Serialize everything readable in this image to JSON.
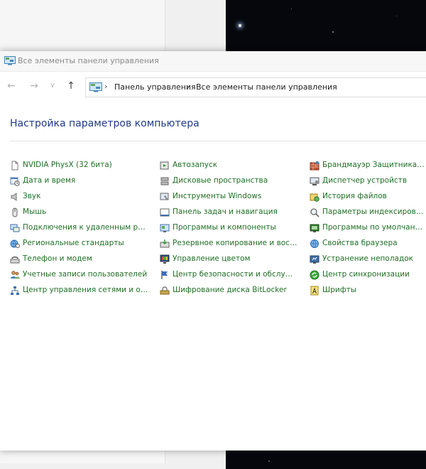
{
  "window": {
    "title": "Все элементы панели управления"
  },
  "navigation": {
    "back_glyph": "←",
    "forward_glyph": "→",
    "recent_glyph": "∨",
    "up_glyph": "↑",
    "separator": "›",
    "breadcrumbs": [
      "Панель управления",
      "Все элементы панели управления"
    ]
  },
  "main": {
    "heading": "Настройка параметров компьютера",
    "columns": [
      [
        {
          "label": "NVIDIA PhysX (32 бита)",
          "icon": "document-icon"
        },
        {
          "label": "Дата и время",
          "icon": "calendar-clock-icon"
        },
        {
          "label": "Звук",
          "icon": "speaker-icon"
        },
        {
          "label": "Мышь",
          "icon": "mouse-icon"
        },
        {
          "label": "Подключения к удаленным рабоч...",
          "icon": "remote-desktop-icon"
        },
        {
          "label": "Региональные стандарты",
          "icon": "globe-clock-icon"
        },
        {
          "label": "Телефон и модем",
          "icon": "phone-modem-icon"
        },
        {
          "label": "Учетные записи пользователей",
          "icon": "users-icon"
        },
        {
          "label": "Центр управления сетями и общи...",
          "icon": "network-icon"
        }
      ],
      [
        {
          "label": "Автозапуск",
          "icon": "autoplay-icon"
        },
        {
          "label": "Дисковые пространства",
          "icon": "storage-spaces-icon"
        },
        {
          "label": "Инструменты Windows",
          "icon": "windows-tools-icon"
        },
        {
          "label": "Панель задач и навигация",
          "icon": "taskbar-icon"
        },
        {
          "label": "Программы и компоненты",
          "icon": "programs-icon"
        },
        {
          "label": "Резервное копирование и восстан...",
          "icon": "backup-icon"
        },
        {
          "label": "Управление цветом",
          "icon": "color-monitor-icon"
        },
        {
          "label": "Центр безопасности и обслуживан...",
          "icon": "flag-icon"
        },
        {
          "label": "Шифрование диска BitLocker",
          "icon": "bitlocker-icon"
        }
      ],
      [
        {
          "label": "Брандмауэр Защитника Windo",
          "icon": "firewall-icon"
        },
        {
          "label": "Диспетчер устройств",
          "icon": "device-manager-icon"
        },
        {
          "label": "История файлов",
          "icon": "file-history-icon"
        },
        {
          "label": "Параметры индексирования",
          "icon": "indexing-icon"
        },
        {
          "label": "Программы по умолчанию",
          "icon": "default-programs-icon"
        },
        {
          "label": "Свойства браузера",
          "icon": "internet-options-icon"
        },
        {
          "label": "Устранение неполадок",
          "icon": "troubleshooting-icon"
        },
        {
          "label": "Центр синхронизации",
          "icon": "sync-center-icon"
        },
        {
          "label": "Шрифты",
          "icon": "fonts-icon"
        }
      ]
    ]
  }
}
